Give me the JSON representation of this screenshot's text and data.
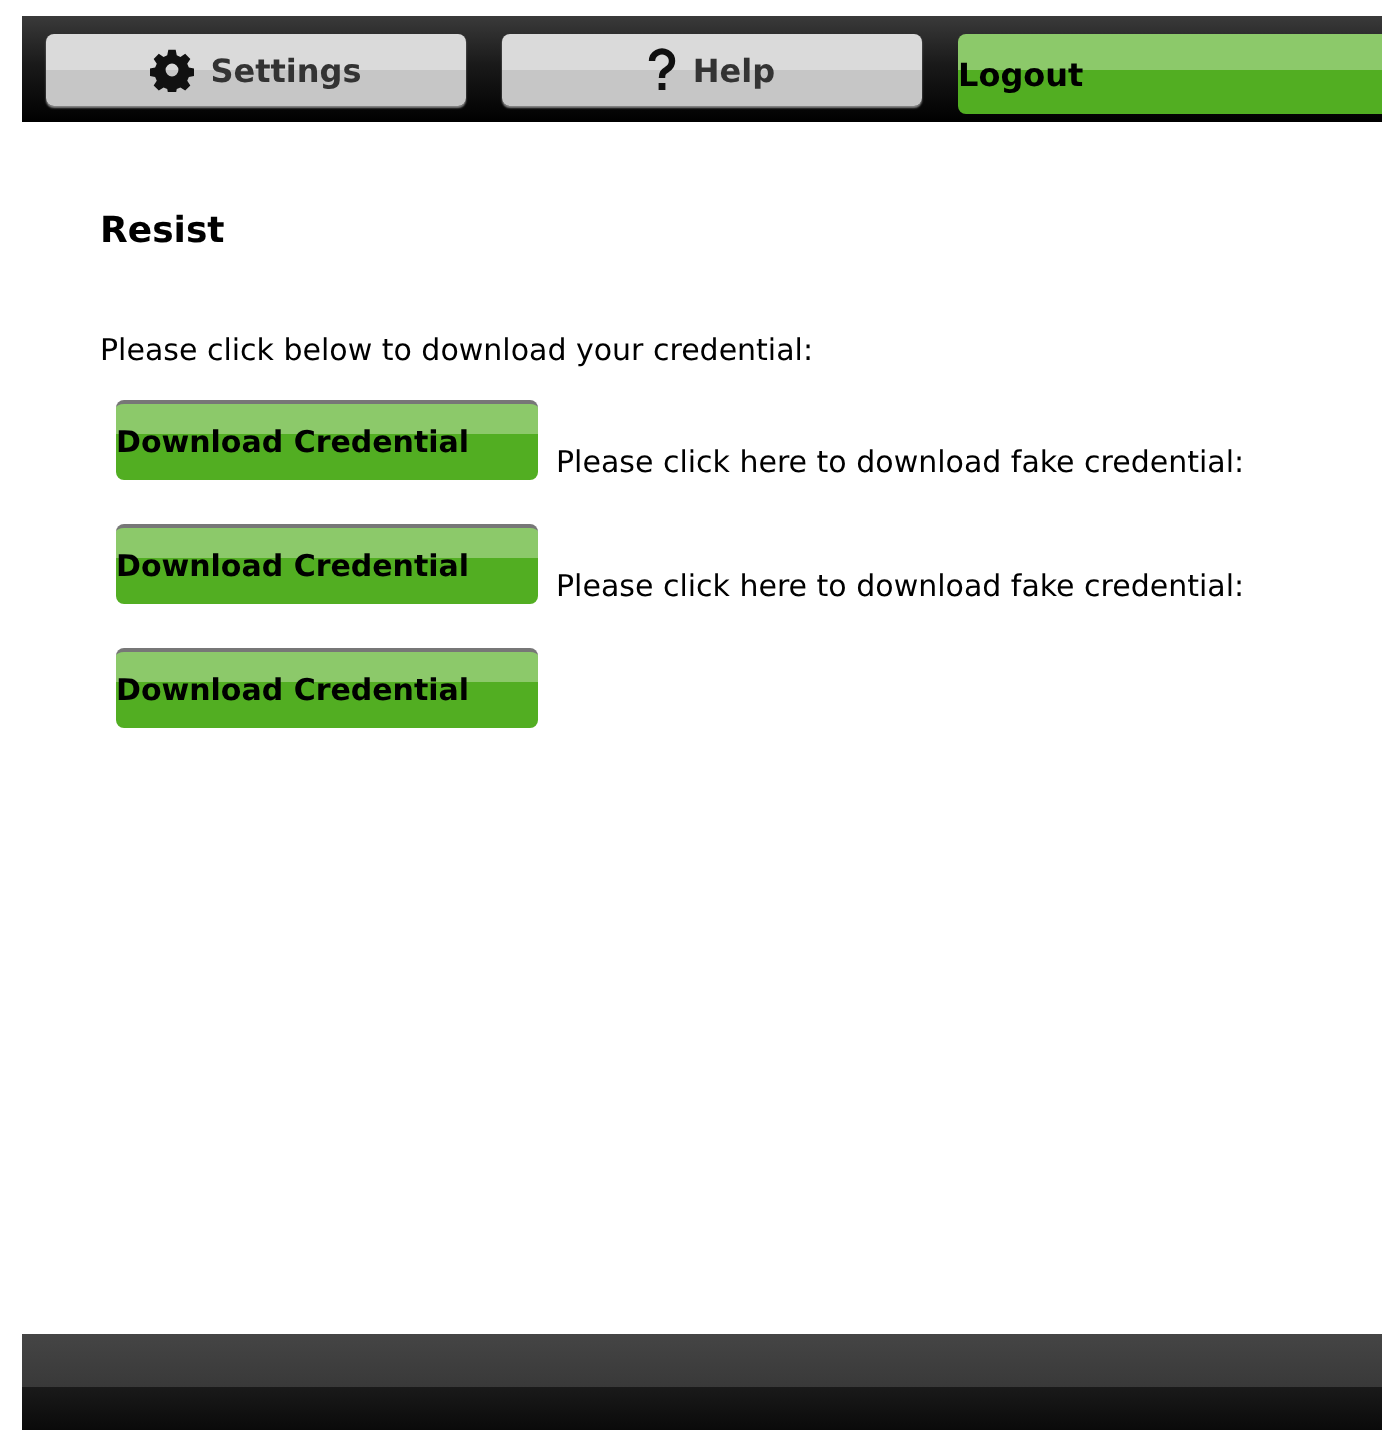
{
  "toolbar": [
    {
      "label": "Settings",
      "kind": "settings"
    },
    {
      "label": "Help",
      "kind": "help"
    },
    {
      "label": "Logout",
      "kind": "logout"
    }
  ],
  "heading": "Resist",
  "intro": "Please click below to download your credential:",
  "downloads": [
    {
      "button": "Download Credential",
      "note": "Please click here to download fake credential:"
    },
    {
      "button": "Download Credential",
      "note": "Please click here to download fake credential:"
    },
    {
      "button": "Download Credential"
    }
  ]
}
